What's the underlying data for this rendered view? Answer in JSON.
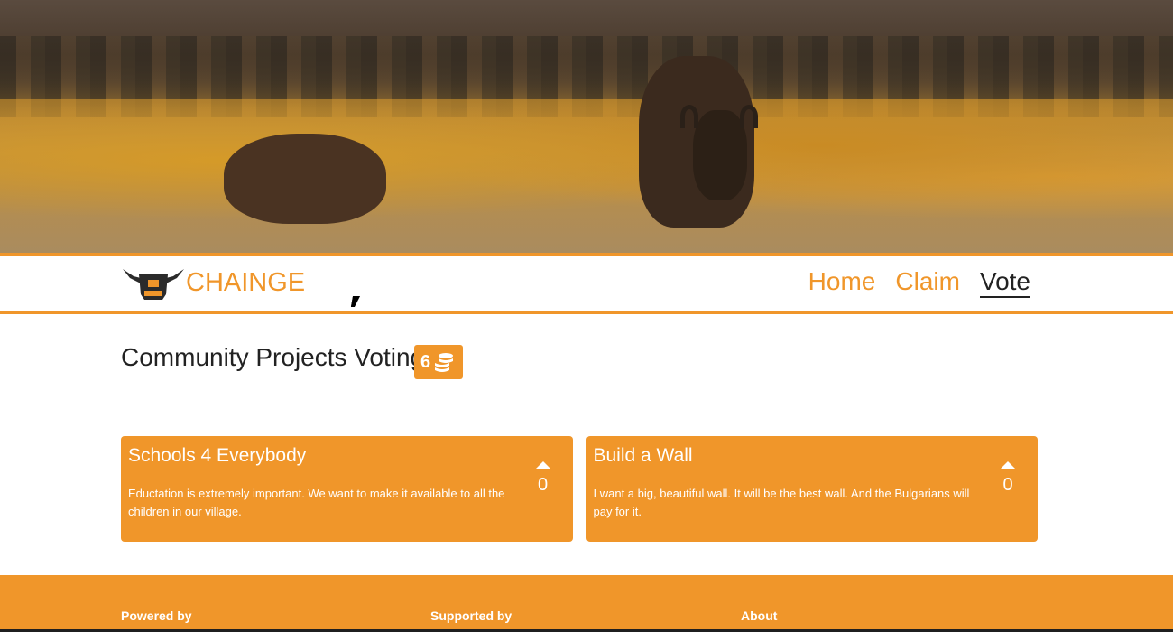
{
  "brand": {
    "name": "CHAINGE"
  },
  "nav": {
    "items": [
      {
        "label": "Home",
        "active": false
      },
      {
        "label": "Claim",
        "active": false
      },
      {
        "label": "Vote",
        "active": true
      }
    ]
  },
  "main": {
    "title": "Community Projects Voting",
    "balance": "6",
    "balance_icon": "coins-icon"
  },
  "projects": [
    {
      "title": "Schools 4 Everybody",
      "description": "Eductation is extremely important. We want to make it available to all the children in our village.",
      "votes": "0"
    },
    {
      "title": "Build a Wall",
      "description": "I want a big, beautiful wall. It will be the best wall. And the Bulgarians will pay for it.",
      "votes": "0"
    }
  ],
  "footer": {
    "powered_by": "Powered by",
    "supported_by": "Supported by",
    "about": "About"
  },
  "colors": {
    "accent": "#f0962a",
    "text": "#222222",
    "footer_border": "#1f1f1f"
  }
}
